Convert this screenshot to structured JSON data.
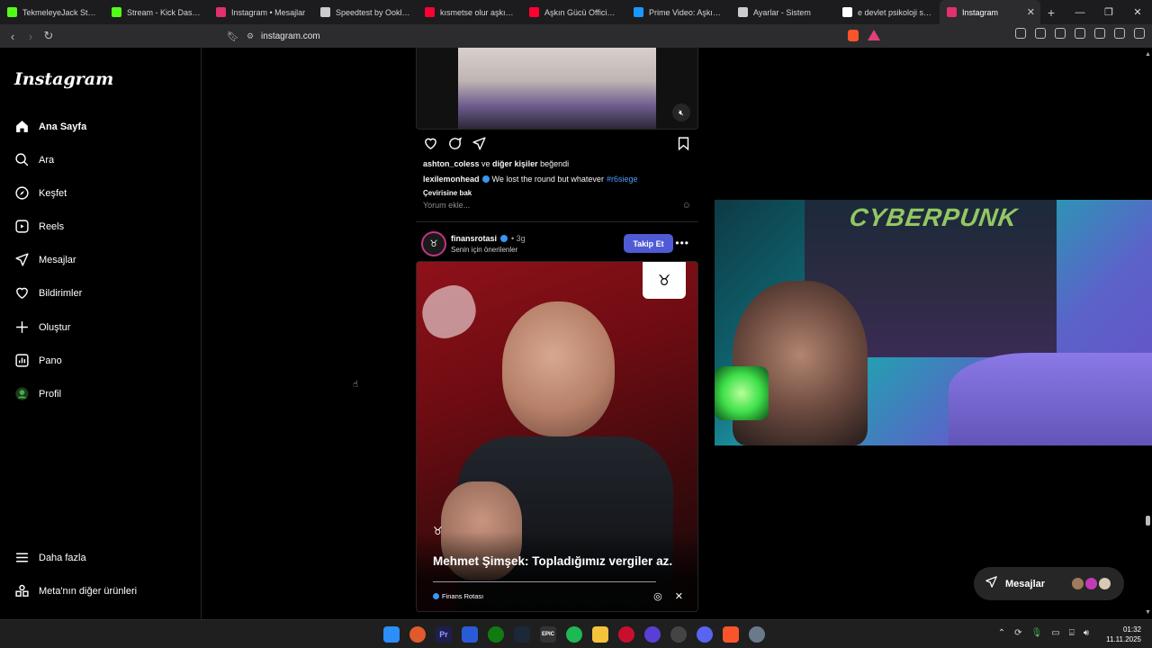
{
  "browser": {
    "tabs": [
      {
        "label": "TekmeleyeJack Stream",
        "icon": "kick-icon",
        "color": "#53fc18"
      },
      {
        "label": "Stream - Kick Dashboa",
        "icon": "kick-icon",
        "color": "#53fc18"
      },
      {
        "label": "Instagram • Mesajlar",
        "icon": "instagram-icon",
        "color": "#e1306c"
      },
      {
        "label": "Speedtest by Ookla - T",
        "icon": "speedtest-icon",
        "color": "#cccccc"
      },
      {
        "label": "kısmetse olur aşkın gü",
        "icon": "youtube-icon",
        "color": "#ff0033"
      },
      {
        "label": "Aşkın Gücü Official - Yo",
        "icon": "youtube-icon",
        "color": "#ff0033"
      },
      {
        "label": "Prime Video: Aşkın Güc",
        "icon": "prime-icon",
        "color": "#1a98ff"
      },
      {
        "label": "Ayarlar - Sistem",
        "icon": "gear-icon",
        "color": "#cccccc"
      },
      {
        "label": "e devlet psikoloji serti",
        "icon": "google-icon",
        "color": "#ffffff"
      },
      {
        "label": "Instagram",
        "icon": "instagram-icon",
        "color": "#e1306c"
      }
    ],
    "new_tab": "+",
    "url": "instagram.com"
  },
  "sidebar": {
    "logo": "Instagram",
    "items": [
      {
        "label": "Ana Sayfa",
        "icon": "home-icon"
      },
      {
        "label": "Ara",
        "icon": "search-icon"
      },
      {
        "label": "Keşfet",
        "icon": "compass-icon"
      },
      {
        "label": "Reels",
        "icon": "reels-icon"
      },
      {
        "label": "Mesajlar",
        "icon": "send-icon"
      },
      {
        "label": "Bildirimler",
        "icon": "heart-icon"
      },
      {
        "label": "Oluştur",
        "icon": "plus-icon"
      },
      {
        "label": "Pano",
        "icon": "chart-icon"
      },
      {
        "label": "Profil",
        "icon": "avatar"
      }
    ],
    "bottom": [
      {
        "label": "Daha fazla",
        "icon": "menu-icon"
      },
      {
        "label": "Meta'nın diğer ürünleri",
        "icon": "grid-icon"
      }
    ]
  },
  "post1": {
    "likes_user": "ashton_coless",
    "likes_mid": " ve ",
    "likes_others": "diğer kişiler",
    "likes_end": " beğendi",
    "caption_user": "lexilemonhead",
    "caption_text": "We lost the round but whatever",
    "hashtag": "#r6siege",
    "translate": "Çevirisine bak",
    "comment_placeholder": "Yorum ekle..."
  },
  "post2": {
    "username": "finansrotasi",
    "time": "• 3g",
    "subtitle": "Senin için önerilenler",
    "follow_label": "Takip Et",
    "headline": "Mehmet Şimşek: Topladığımız vergiler az.",
    "source": "Finans Rotası"
  },
  "messages_pill": {
    "label": "Mesajlar"
  },
  "webcam": {
    "poster_text": "CYBERPUNK"
  },
  "clock": {
    "time": "01:32",
    "date": "11.11.2025"
  }
}
